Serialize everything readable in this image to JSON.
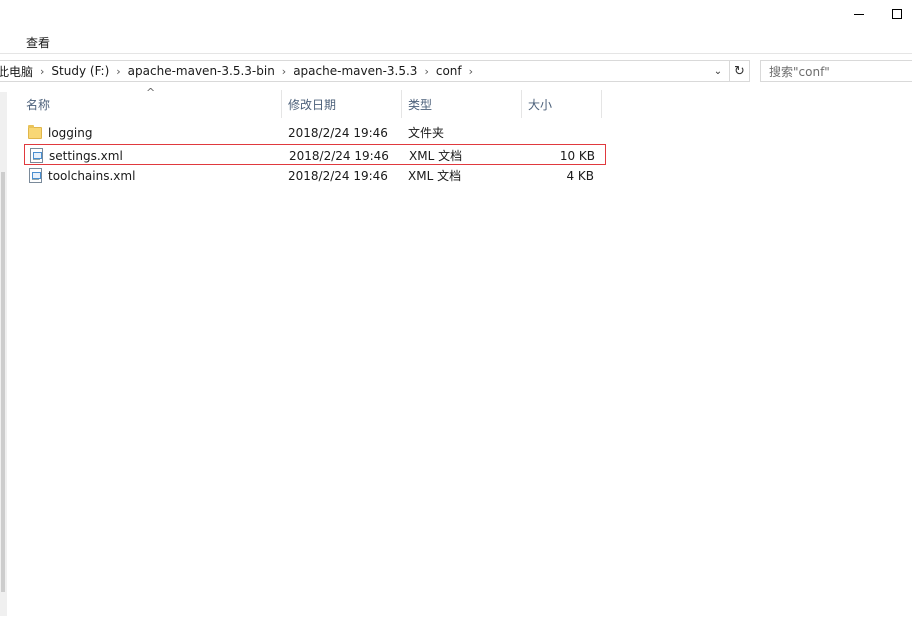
{
  "ribbon": {
    "view_tab": "查看"
  },
  "address": {
    "crumbs": [
      "此电脑",
      "Study (F:)",
      "apache-maven-3.5.3-bin",
      "apache-maven-3.5.3",
      "conf"
    ]
  },
  "search": {
    "placeholder": "搜索\"conf\""
  },
  "columns": {
    "name": "名称",
    "date": "修改日期",
    "type": "类型",
    "size": "大小"
  },
  "files": [
    {
      "name": "logging",
      "date": "2018/2/24 19:46",
      "type": "文件夹",
      "size": "",
      "icon": "folder-icon"
    },
    {
      "name": "settings.xml",
      "date": "2018/2/24 19:46",
      "type": "XML 文档",
      "size": "10 KB",
      "icon": "xml-file-icon",
      "highlighted": true
    },
    {
      "name": "toolchains.xml",
      "date": "2018/2/24 19:46",
      "type": "XML 文档",
      "size": "4 KB",
      "icon": "xml-file-icon"
    }
  ],
  "colors": {
    "highlight_border": "#e0393e",
    "header_text": "#4c607a"
  }
}
